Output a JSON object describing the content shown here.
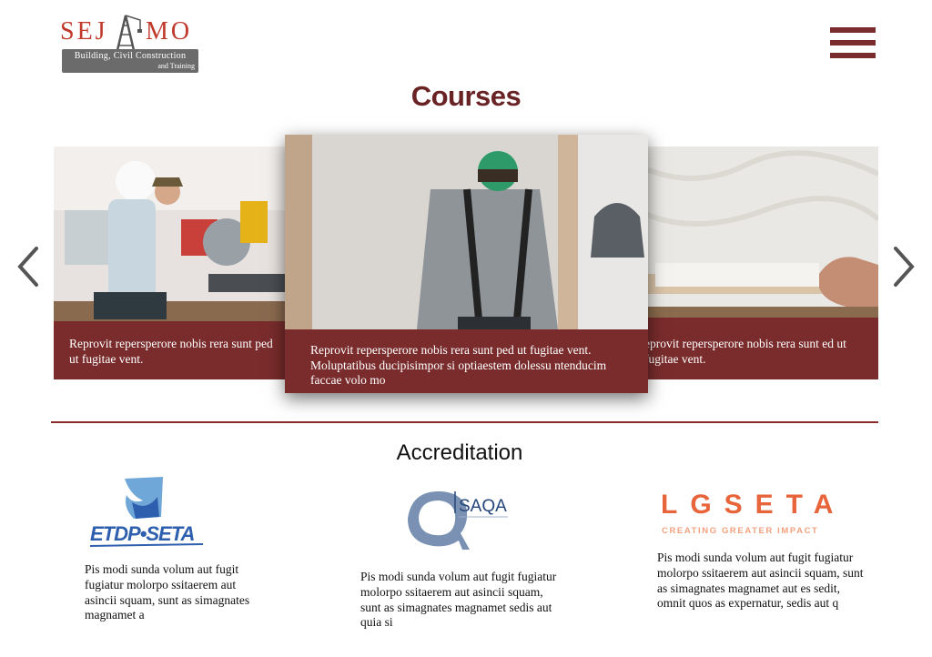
{
  "brand": {
    "logo_text": "SEJAMO",
    "logo_tagline_line1": "Building, Civil Construction",
    "logo_tagline_line2": "and Training"
  },
  "nav": {
    "menu_icon": "hamburger-menu-icon"
  },
  "courses": {
    "title": "Courses",
    "prev_icon": "chevron-left-icon",
    "next_icon": "chevron-right-icon",
    "cards": [
      {
        "caption": "Reprovit repersperore nobis rera sunt ped ut fugitae vent."
      },
      {
        "caption": "Reprovit repersperore nobis rera sunt ped ut fugitae vent. Moluptatibus ducipisimpor si optiaestem dolessu ntenducim faccae volo mo"
      },
      {
        "caption": "eprovit repersperore nobis rera sunt ed ut fugitae vent."
      }
    ]
  },
  "accreditation": {
    "title": "Accreditation",
    "items": [
      {
        "logo_text": "ETDP SETA",
        "description": "Pis modi sunda volum aut fugit fugiatur molorpo ssitaerem aut asincii squam, sunt as simagnates magnamet a"
      },
      {
        "logo_text": "SAQA",
        "description": "Pis modi sunda volum aut fugit fugiatur molorpo ssitaerem aut asincii squam, sunt as simagnates magnamet sedis aut quia si"
      },
      {
        "logo_text": "LGSETA",
        "logo_subtext": "CREATING GREATER IMPACT",
        "description": "Pis modi sunda volum aut fugit fugiatur molorpo ssitaerem aut asincii squam, sunt as simagnates magnamet aut es sedit, omnit quos as expernatur, sedis aut q"
      }
    ]
  },
  "colors": {
    "brand": "#7a2c2c",
    "title": "#6a2324",
    "logo_red": "#c0392b",
    "lgseta_orange": "#e8643a",
    "etdp_blue": "#2d5fae"
  }
}
